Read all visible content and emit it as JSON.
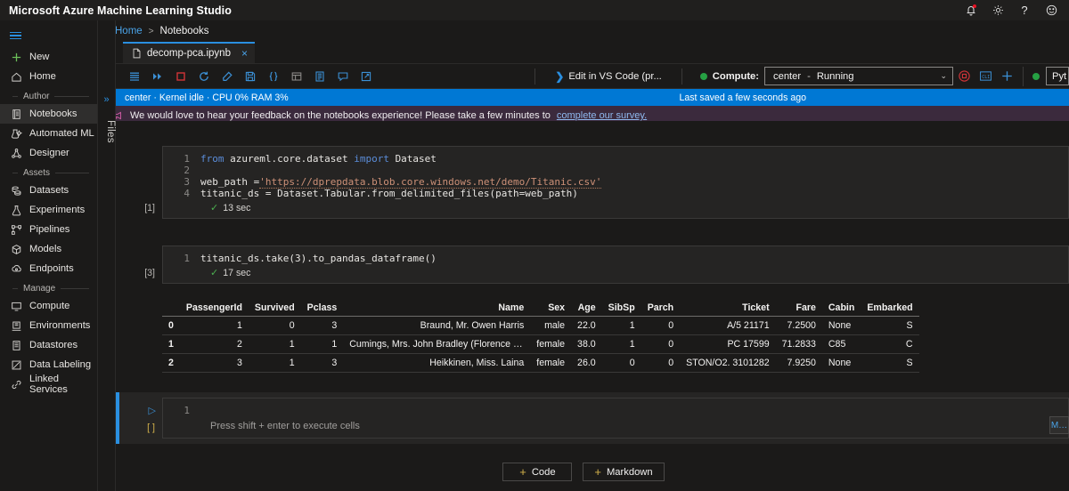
{
  "topbar": {
    "title": "Microsoft Azure Machine Learning Studio",
    "icons": [
      {
        "name": "notifications-icon",
        "glyph": "♡"
      },
      {
        "name": "settings-gear-icon",
        "glyph": "⚙"
      },
      {
        "name": "help-icon",
        "glyph": "?"
      },
      {
        "name": "feedback-smiley-icon",
        "glyph": "☺"
      }
    ]
  },
  "sidebar": {
    "hamburger": "menu-icon",
    "primary": [
      {
        "label": "New",
        "icon": "plus-icon"
      },
      {
        "label": "Home",
        "icon": "home-icon"
      }
    ],
    "groups": [
      {
        "title": "Author",
        "items": [
          {
            "label": "Notebooks",
            "icon": "notebook-icon",
            "active": true
          },
          {
            "label": "Automated ML",
            "icon": "automated-ml-icon",
            "active": false
          },
          {
            "label": "Designer",
            "icon": "designer-icon",
            "active": false
          }
        ]
      },
      {
        "title": "Assets",
        "items": [
          {
            "label": "Datasets",
            "icon": "datasets-icon",
            "active": false
          },
          {
            "label": "Experiments",
            "icon": "experiments-flask-icon",
            "active": false
          },
          {
            "label": "Pipelines",
            "icon": "pipelines-icon",
            "active": false
          },
          {
            "label": "Models",
            "icon": "models-cube-icon",
            "active": false
          },
          {
            "label": "Endpoints",
            "icon": "endpoints-icon",
            "active": false
          }
        ]
      },
      {
        "title": "Manage",
        "items": [
          {
            "label": "Compute",
            "icon": "compute-monitor-icon",
            "active": false
          },
          {
            "label": "Environments",
            "icon": "environments-icon",
            "active": false
          },
          {
            "label": "Datastores",
            "icon": "datastores-icon",
            "active": false
          },
          {
            "label": "Data Labeling",
            "icon": "data-labeling-icon",
            "active": false
          },
          {
            "label": "Linked Services",
            "icon": "linked-services-icon",
            "active": false
          }
        ]
      }
    ]
  },
  "breadcrumb": {
    "home": "Home",
    "separator": ">",
    "current": "Notebooks"
  },
  "tab": {
    "label": "decomp-pca.ipynb",
    "close": "×",
    "file_icon": "notebook-file-icon"
  },
  "toolbar": {
    "icons": [
      {
        "name": "menu-list-icon",
        "glyph": "☰"
      },
      {
        "name": "run-all-icon",
        "glyph": "▶▶"
      },
      {
        "name": "stop-icon",
        "glyph": "□"
      },
      {
        "name": "restart-kernel-icon",
        "glyph": "↻"
      },
      {
        "name": "clear-outputs-icon",
        "glyph": "◇"
      },
      {
        "name": "save-icon",
        "glyph": "Ὃe"
      },
      {
        "name": "format-code-icon",
        "glyph": "{ }"
      },
      {
        "name": "variable-explorer-icon",
        "glyph": "▦"
      },
      {
        "name": "notebook-outline-icon",
        "glyph": "☷"
      },
      {
        "name": "comments-icon",
        "glyph": "▭"
      },
      {
        "name": "open-external-icon",
        "glyph": "↗"
      }
    ],
    "vscode_button": "Edit in VS Code (pr...",
    "compute_label": "Compute:",
    "compute_name": "center",
    "compute_dash": "-",
    "compute_status": "Running",
    "chevron": "⌄",
    "compute_actions": [
      {
        "name": "stop-compute-icon",
        "glyph": "◉"
      },
      {
        "name": "terminal-cli-icon",
        "glyph": "CLI"
      },
      {
        "name": "new-compute-icon",
        "glyph": "+"
      }
    ],
    "kernel_name": "Pyt"
  },
  "kernel_strip": {
    "status": "center · Kernel idle · CPU  0%  RAM  3%",
    "saved": "Last saved a few seconds ago"
  },
  "banner": {
    "icon": "feedback-megaphone-icon",
    "text": "We would love to hear your feedback on the notebooks experience! Please take a few minutes to ",
    "link": "complete our survey."
  },
  "files_panel": {
    "expand_chevron": "»",
    "label": "Files"
  },
  "notebook": {
    "cells": [
      {
        "exec_count": "[1]",
        "lines": [
          {
            "num": "1",
            "segments": [
              {
                "t": "from ",
                "c": "kw"
              },
              {
                "t": "azureml.core.dataset ",
                "c": ""
              },
              {
                "t": "import ",
                "c": "kw"
              },
              {
                "t": "Dataset",
                "c": ""
              }
            ]
          },
          {
            "num": "2",
            "segments": [
              {
                "t": "",
                "c": ""
              }
            ]
          },
          {
            "num": "3",
            "segments": [
              {
                "t": "web_path =",
                "c": ""
              },
              {
                "t": "'https://dprepdata.blob.core.windows.net/demo/Titanic.csv'",
                "c": "str"
              }
            ]
          },
          {
            "num": "4",
            "segments": [
              {
                "t": "titanic_ds = Dataset.Tabular.from_delimited_files(path=web_path)",
                "c": ""
              }
            ]
          }
        ],
        "status_tick": "✓",
        "status_time": "13 sec"
      },
      {
        "exec_count": "[3]",
        "lines": [
          {
            "num": "1",
            "segments": [
              {
                "t": "titanic_ds.take(",
                "c": ""
              },
              {
                "t": "3",
                "c": "num"
              },
              {
                "t": ").to_pandas_dataframe()",
                "c": ""
              }
            ]
          }
        ],
        "status_tick": "✓",
        "status_time": "17 sec"
      }
    ],
    "active_cell": {
      "run_icon": "▷",
      "exec_count": "[ ]",
      "line_num": "1",
      "hint": "Press shift + enter to execute cells"
    },
    "output_table": {
      "columns": [
        "",
        "PassengerId",
        "Survived",
        "Pclass",
        "Name",
        "Sex",
        "Age",
        "SibSp",
        "Parch",
        "Ticket",
        "Fare",
        "Cabin",
        "Embarked"
      ],
      "rows": [
        [
          "0",
          "1",
          "0",
          "3",
          "Braund, Mr. Owen Harris",
          "male",
          "22.0",
          "1",
          "0",
          "A/5 21171",
          "7.2500",
          "None",
          "S"
        ],
        [
          "1",
          "2",
          "1",
          "1",
          "Cumings, Mrs. John Bradley (Florence Briggs Th...",
          "female",
          "38.0",
          "1",
          "0",
          "PC 17599",
          "71.2833",
          "C85",
          "C"
        ],
        [
          "2",
          "3",
          "1",
          "3",
          "Heikkinen, Miss. Laina",
          "female",
          "26.0",
          "0",
          "0",
          "STON/O2. 3101282",
          "7.9250",
          "None",
          "S"
        ]
      ]
    },
    "side_button": "M…"
  },
  "add_buttons": [
    {
      "label": "Code",
      "plus": "+",
      "name": "add-code-cell-button"
    },
    {
      "label": "Markdown",
      "plus": "+",
      "name": "add-markdown-cell-button"
    }
  ],
  "colors": {
    "accent": "#0078d4",
    "running": "#26a043",
    "stop": "#d13438",
    "banner_bg": "#3b2a3d"
  }
}
